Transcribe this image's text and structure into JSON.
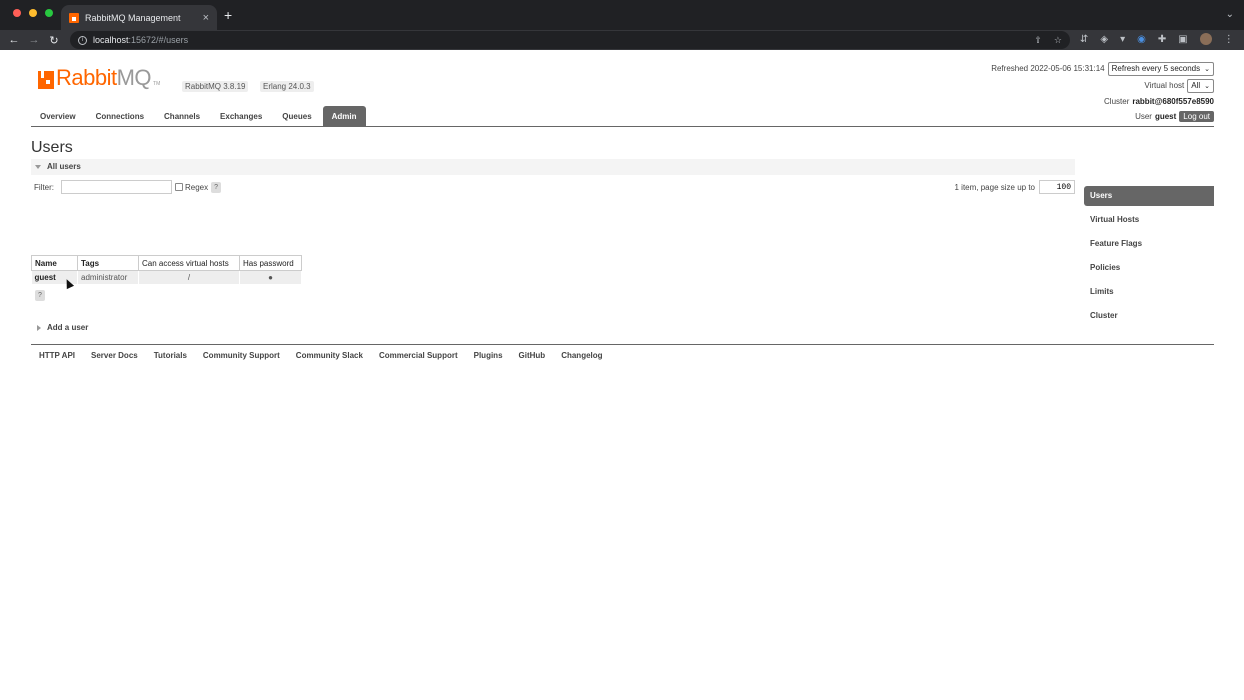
{
  "browser": {
    "tab_title": "RabbitMQ Management",
    "tab_close": "×",
    "new_tab": "+",
    "url_host": "localhost",
    "url_path": ":15672/#/users"
  },
  "header": {
    "logo_rabbit": "Rabbit",
    "logo_mq": "MQ",
    "logo_tm": "TM",
    "rabbitmq_version": "RabbitMQ 3.8.19",
    "erlang_version": "Erlang 24.0.3",
    "refreshed_label": "Refreshed 2022-05-06 15:31:14",
    "refresh_select": "Refresh every 5 seconds",
    "virtual_host_label": "Virtual host",
    "virtual_host_select": "All",
    "cluster_label": "Cluster",
    "cluster_name": "rabbit@680f557e8590",
    "user_label": "User",
    "user_name": "guest",
    "logout_label": "Log out"
  },
  "nav": {
    "tabs": [
      "Overview",
      "Connections",
      "Channels",
      "Exchanges",
      "Queues",
      "Admin"
    ],
    "active": "Admin"
  },
  "main": {
    "title": "Users",
    "section_title": "All users",
    "filter_label": "Filter:",
    "filter_value": "",
    "regex_label": "Regex",
    "help": "?",
    "paging_text": "1 item, page size up to",
    "page_size": "100",
    "table": {
      "headers": [
        "Name",
        "Tags",
        "Can access virtual hosts",
        "Has password"
      ],
      "rows": [
        {
          "name": "guest",
          "tags": "administrator",
          "vhosts": "/",
          "has_password": "●"
        }
      ]
    },
    "add_user": "Add a user"
  },
  "sidebar": {
    "items": [
      "Users",
      "Virtual Hosts",
      "Feature Flags",
      "Policies",
      "Limits",
      "Cluster"
    ],
    "active": "Users"
  },
  "footer": {
    "links": [
      "HTTP API",
      "Server Docs",
      "Tutorials",
      "Community Support",
      "Community Slack",
      "Commercial Support",
      "Plugins",
      "GitHub",
      "Changelog"
    ]
  }
}
